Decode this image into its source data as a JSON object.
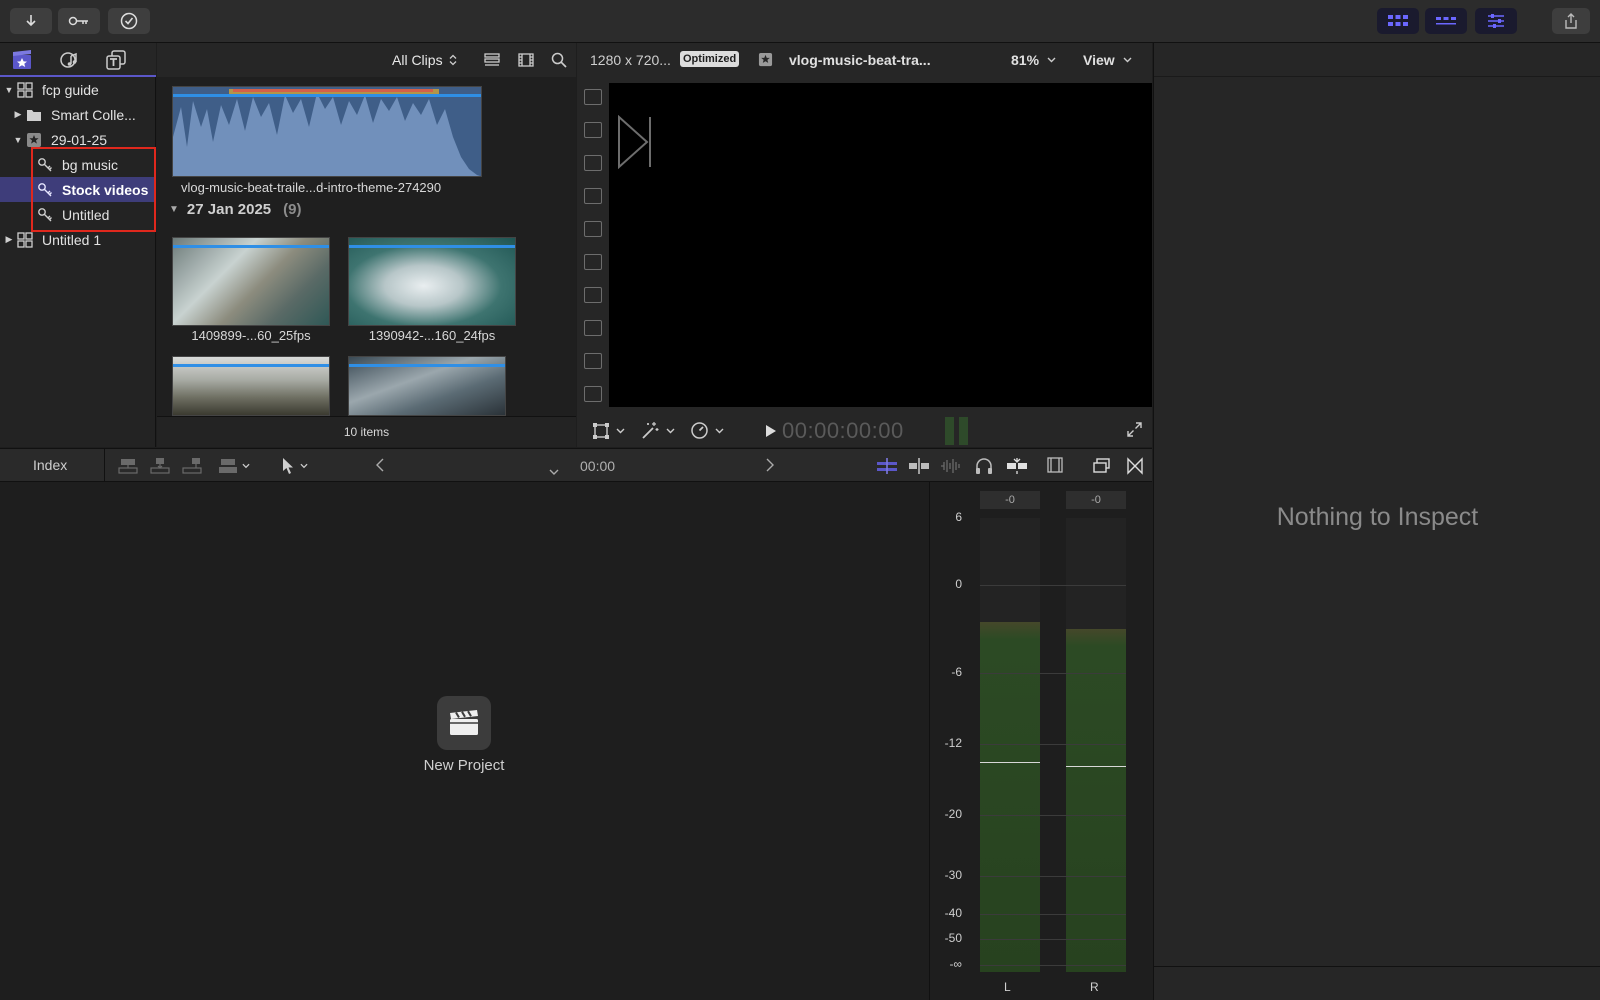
{
  "sidebar": {
    "items": [
      {
        "label": "fcp guide"
      },
      {
        "label": "Smart Colle..."
      },
      {
        "label": "29-01-25"
      },
      {
        "label": "bg music"
      },
      {
        "label": "Stock videos"
      },
      {
        "label": "Untitled"
      },
      {
        "label": "Untitled 1"
      }
    ]
  },
  "browser": {
    "filter_label": "All Clips",
    "audio_clip_label": "vlog-music-beat-traile...d-intro-theme-274290",
    "date_group": {
      "label": "27 Jan 2025",
      "count": "(9)"
    },
    "clips": [
      {
        "label": "1409899-...60_25fps"
      },
      {
        "label": "1390942-...160_24fps"
      }
    ],
    "footer": "10 items"
  },
  "viewer": {
    "resolution": "1280 x 720...",
    "badge": "Optimized",
    "clip_name": "vlog-music-beat-tra...",
    "zoom": "81%",
    "view_label": "View",
    "timecode": "00:00:00:00"
  },
  "inspector": {
    "empty_text": "Nothing to Inspect"
  },
  "timeline": {
    "index_label": "Index",
    "timecode": "00:00",
    "new_project_label": "New Project"
  },
  "meters": {
    "peak_left": "-0",
    "peak_right": "-0",
    "scale": [
      "6",
      "0",
      "-6",
      "-12",
      "-20",
      "-30",
      "-40",
      "-50",
      "-∞"
    ],
    "channel_left": "L",
    "channel_right": "R",
    "level_left_db": -2.5,
    "level_right_db": -3.0,
    "peak_hold_left_db": -14,
    "peak_hold_right_db": -14.5
  },
  "colors": {
    "accent": "#5b57c9",
    "selection": "#3e3d7a",
    "highlight_box": "#e0281d",
    "clip_bar": "#2f8fe6",
    "meter_green": "#2c4a24"
  }
}
